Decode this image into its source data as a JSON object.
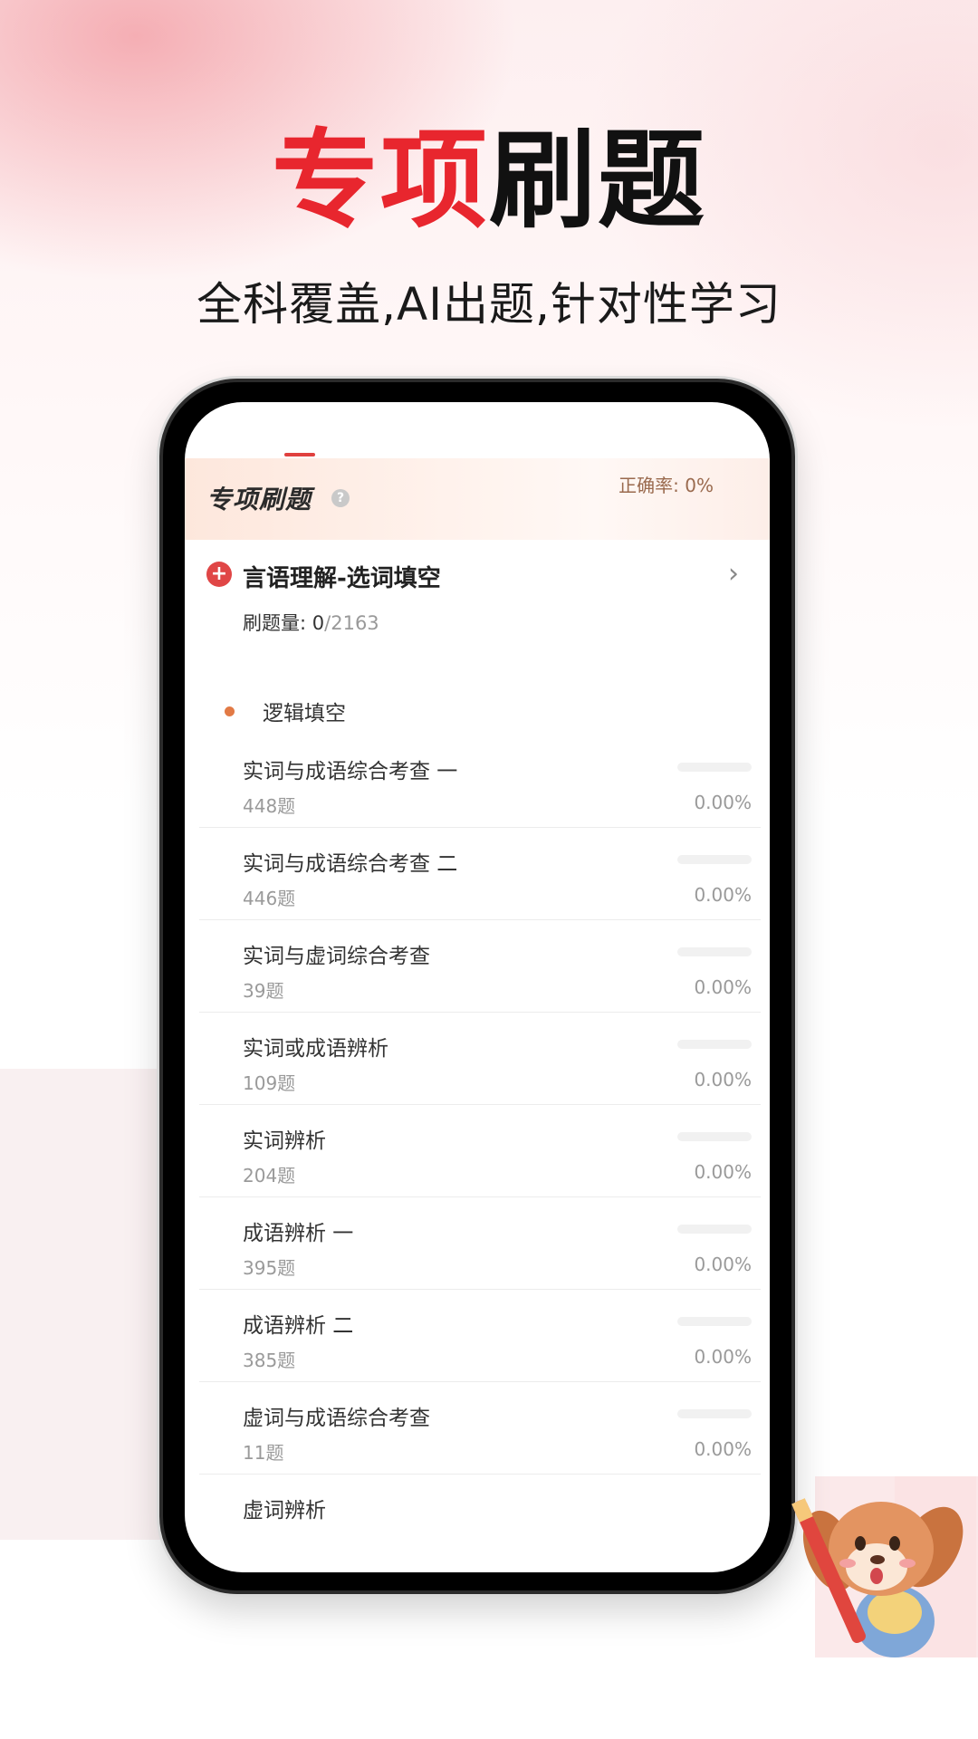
{
  "hero": {
    "title_red": "专项",
    "title_black": "刷题",
    "subtitle": "全科覆盖,AI出题,针对性学习"
  },
  "screen": {
    "section_title": "专项刷题",
    "help_icon": "?",
    "accuracy_label": "正确率: ",
    "accuracy_value": "0%",
    "category": {
      "icon": "+",
      "name": "言语理解-选词填空",
      "count_label": "刷题量: ",
      "done": "0",
      "total": "/2163"
    },
    "subcategory": "逻辑填空",
    "items": [
      {
        "title": "实词与成语综合考查 一",
        "count": "448题",
        "percent": "0.00%",
        "progress": 0
      },
      {
        "title": "实词与成语综合考查 二",
        "count": "446题",
        "percent": "0.00%",
        "progress": 0
      },
      {
        "title": "实词与虚词综合考查",
        "count": "39题",
        "percent": "0.00%",
        "progress": 0
      },
      {
        "title": "实词或成语辨析",
        "count": "109题",
        "percent": "0.00%",
        "progress": 0
      },
      {
        "title": "实词辨析",
        "count": "204题",
        "percent": "0.00%",
        "progress": 0
      },
      {
        "title": "成语辨析 一",
        "count": "395题",
        "percent": "0.00%",
        "progress": 0
      },
      {
        "title": "成语辨析 二",
        "count": "385题",
        "percent": "0.00%",
        "progress": 0
      },
      {
        "title": "虚词与成语综合考查",
        "count": "11题",
        "percent": "0.00%",
        "progress": 0
      }
    ],
    "partial_item": {
      "title": "虚词辨析"
    }
  },
  "colors": {
    "accent": "#e8262e",
    "progress": "#e0403e"
  }
}
